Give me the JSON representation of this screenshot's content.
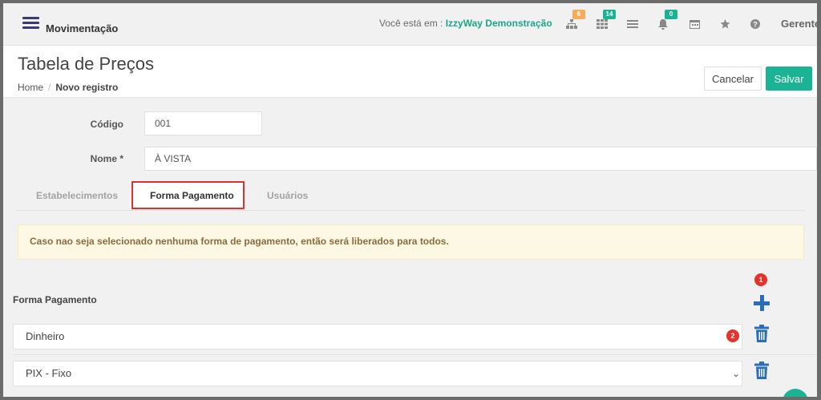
{
  "topbar": {
    "brand": "Movimentação",
    "location_prefix": "Você está em : ",
    "location_name": "IzzyWay Demonstração",
    "icons": [
      {
        "name": "sitemap-icon",
        "badge": "6",
        "badge_color": "#f8ac59"
      },
      {
        "name": "grid-icon",
        "badge": "14",
        "badge_color": "#1ab394"
      },
      {
        "name": "list-icon",
        "badge": null
      },
      {
        "name": "bell-icon",
        "badge": "0",
        "badge_color": "#1ab394"
      },
      {
        "name": "calendar-icon",
        "badge": null
      },
      {
        "name": "star-icon",
        "badge": null
      },
      {
        "name": "help-icon",
        "badge": null
      }
    ],
    "user": "Gerente"
  },
  "header": {
    "title": "Tabela de Preços",
    "breadcrumb_home": "Home",
    "breadcrumb_separator": "/",
    "breadcrumb_current": "Novo registro",
    "cancel_label": "Cancelar",
    "save_label": "Salvar"
  },
  "form": {
    "codigo_label": "Código",
    "codigo_value": "001",
    "nome_label": "Nome *",
    "nome_value": "À VISTA"
  },
  "tabs": [
    {
      "label": "Estabelecimentos",
      "active": false
    },
    {
      "label": "Forma Pagamento",
      "active": true
    },
    {
      "label": "Usuários",
      "active": false
    }
  ],
  "alert": {
    "text": "Caso nao seja selecionado nenhuma forma de pagamento, então será liberados para todos."
  },
  "payments": {
    "section_label": "Forma Pagamento",
    "marker_add": "1",
    "marker_row": "2",
    "rows": [
      {
        "value": "Dinheiro",
        "type": "input"
      },
      {
        "value": "PIX - Fixo",
        "type": "select"
      }
    ]
  },
  "colors": {
    "accent": "#1ab394",
    "primary_blue": "#2a6fb5",
    "marker_red": "#e8302c",
    "alert_bg": "#fcf8e3",
    "alert_text": "#8a6d3b"
  }
}
